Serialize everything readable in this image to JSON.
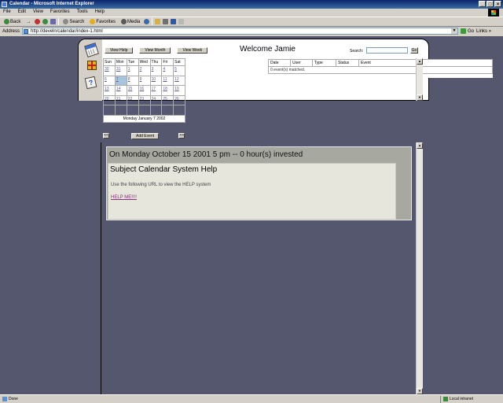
{
  "window": {
    "title": "Calendar - Microsoft Internet Explorer",
    "buttons": [
      "_",
      "□",
      "×"
    ]
  },
  "menu": [
    "File",
    "Edit",
    "View",
    "Favorites",
    "Tools",
    "Help"
  ],
  "toolbar": {
    "back": "Back",
    "forward": "→",
    "search": "Search",
    "favorites": "Favorites",
    "media": "Media"
  },
  "address": {
    "label": "Address",
    "url": "http://develn/calendar/index-1.html",
    "go": "Go",
    "links": "Links »"
  },
  "header": {
    "nav_buttons": [
      "View Help",
      "View Month",
      "View Week"
    ],
    "welcome": "Welcome Jamie",
    "search_label": "Search:",
    "search_value": "",
    "search_go": "Go"
  },
  "calendar": {
    "weekdays": [
      "Sun",
      "Mon",
      "Tue",
      "Wed",
      "Thu",
      "Fri",
      "Sat"
    ],
    "weeks": [
      [
        "30",
        "31",
        "1",
        "2",
        "3",
        "4",
        "5"
      ],
      [
        "6",
        "7",
        "8",
        "9",
        "10",
        "11",
        "12"
      ],
      [
        "13",
        "14",
        "15",
        "16",
        "17",
        "18",
        "19"
      ],
      [
        "20",
        "21",
        "22",
        "23",
        "24",
        "25",
        "26"
      ],
      [
        "27",
        "28",
        "29",
        "30",
        "31",
        "1",
        "2"
      ]
    ],
    "selected_day": "7",
    "caption": "Monday January 7 2002",
    "prev": "<<",
    "next": ">>",
    "add_event": "Add Event"
  },
  "events": {
    "columns": [
      "Date",
      "User",
      "Type",
      "Status",
      "Event"
    ],
    "message": "0 event(s) matched."
  },
  "help": {
    "header": "On Monday October 15 2001 5 pm -- 0 hour(s) invested",
    "title": "Subject Calendar System Help",
    "text": "Use the following URL to view the HELP system",
    "link": "HELP ME!!!!"
  },
  "status": {
    "text": "Done",
    "zone": "Local intranet"
  },
  "colors": {
    "page_bg": "#55576f",
    "help_panel": "#a7a9a0",
    "help_inner": "#e6e6dc",
    "selected_day": "#a8c4dc"
  }
}
